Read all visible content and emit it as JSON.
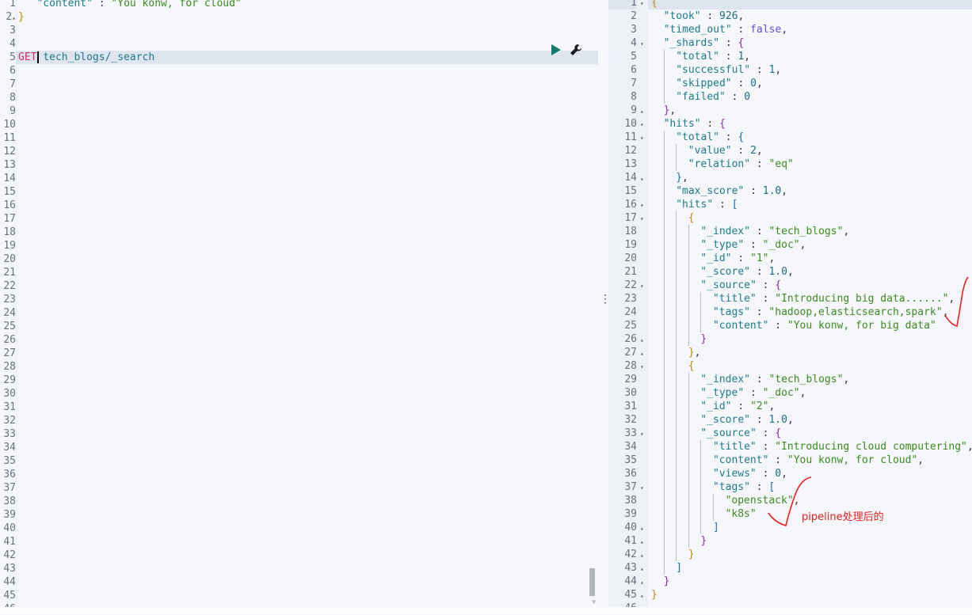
{
  "request_editor": {
    "lines": [
      {
        "num": "1",
        "fold": "",
        "tokens": [
          [
            "p",
            "   "
          ],
          [
            "k",
            "\"content\""
          ],
          [
            "p",
            " : "
          ],
          [
            "s",
            "\"You konw, for cloud\""
          ]
        ]
      },
      {
        "num": "2",
        "fold": "up",
        "tokens": [
          [
            "br1",
            "}"
          ]
        ]
      },
      {
        "num": "3",
        "fold": "",
        "tokens": []
      },
      {
        "num": "4",
        "fold": "",
        "tokens": []
      },
      {
        "num": "5",
        "fold": "",
        "active": true,
        "tokens": [
          [
            "m",
            "GET"
          ],
          [
            "p",
            " "
          ],
          [
            "u",
            "tech_blogs/_search"
          ]
        ]
      }
    ],
    "total_lines": 46,
    "run_button": "play-icon",
    "settings_button": "wrench-icon"
  },
  "response_viewer": {
    "lines": [
      {
        "num": "1",
        "fold": "down",
        "indent": 0,
        "tokens": [
          [
            "br1",
            "{"
          ]
        ]
      },
      {
        "num": "2",
        "fold": "",
        "indent": 1,
        "tokens": [
          [
            "k",
            "\"took\""
          ],
          [
            "p",
            " : "
          ],
          [
            "n",
            "926"
          ],
          [
            "p",
            ","
          ]
        ]
      },
      {
        "num": "3",
        "fold": "",
        "indent": 1,
        "tokens": [
          [
            "k",
            "\"timed_out\""
          ],
          [
            "p",
            " : "
          ],
          [
            "b",
            "false"
          ],
          [
            "p",
            ","
          ]
        ]
      },
      {
        "num": "4",
        "fold": "down",
        "indent": 1,
        "tokens": [
          [
            "k",
            "\"_shards\""
          ],
          [
            "p",
            " : "
          ],
          [
            "br2",
            "{"
          ]
        ]
      },
      {
        "num": "5",
        "fold": "",
        "indent": 2,
        "tokens": [
          [
            "k",
            "\"total\""
          ],
          [
            "p",
            " : "
          ],
          [
            "n",
            "1"
          ],
          [
            "p",
            ","
          ]
        ]
      },
      {
        "num": "6",
        "fold": "",
        "indent": 2,
        "tokens": [
          [
            "k",
            "\"successful\""
          ],
          [
            "p",
            " : "
          ],
          [
            "n",
            "1"
          ],
          [
            "p",
            ","
          ]
        ]
      },
      {
        "num": "7",
        "fold": "",
        "indent": 2,
        "tokens": [
          [
            "k",
            "\"skipped\""
          ],
          [
            "p",
            " : "
          ],
          [
            "n",
            "0"
          ],
          [
            "p",
            ","
          ]
        ]
      },
      {
        "num": "8",
        "fold": "",
        "indent": 2,
        "tokens": [
          [
            "k",
            "\"failed\""
          ],
          [
            "p",
            " : "
          ],
          [
            "n",
            "0"
          ]
        ]
      },
      {
        "num": "9",
        "fold": "up",
        "indent": 1,
        "tokens": [
          [
            "br2",
            "}"
          ],
          [
            "p",
            ","
          ]
        ]
      },
      {
        "num": "10",
        "fold": "down",
        "indent": 1,
        "tokens": [
          [
            "k",
            "\"hits\""
          ],
          [
            "p",
            " : "
          ],
          [
            "br2",
            "{"
          ]
        ]
      },
      {
        "num": "11",
        "fold": "down",
        "indent": 2,
        "tokens": [
          [
            "k",
            "\"total\""
          ],
          [
            "p",
            " : "
          ],
          [
            "br3",
            "{"
          ]
        ]
      },
      {
        "num": "12",
        "fold": "",
        "indent": 3,
        "tokens": [
          [
            "k",
            "\"value\""
          ],
          [
            "p",
            " : "
          ],
          [
            "n",
            "2"
          ],
          [
            "p",
            ","
          ]
        ]
      },
      {
        "num": "13",
        "fold": "",
        "indent": 3,
        "tokens": [
          [
            "k",
            "\"relation\""
          ],
          [
            "p",
            " : "
          ],
          [
            "s",
            "\"eq\""
          ]
        ]
      },
      {
        "num": "14",
        "fold": "up",
        "indent": 2,
        "tokens": [
          [
            "br3",
            "}"
          ],
          [
            "p",
            ","
          ]
        ]
      },
      {
        "num": "15",
        "fold": "",
        "indent": 2,
        "tokens": [
          [
            "k",
            "\"max_score\""
          ],
          [
            "p",
            " : "
          ],
          [
            "n",
            "1.0"
          ],
          [
            "p",
            ","
          ]
        ]
      },
      {
        "num": "16",
        "fold": "down",
        "indent": 2,
        "tokens": [
          [
            "k",
            "\"hits\""
          ],
          [
            "p",
            " : "
          ],
          [
            "br3",
            "["
          ]
        ]
      },
      {
        "num": "17",
        "fold": "down",
        "indent": 3,
        "tokens": [
          [
            "br1",
            "{"
          ]
        ]
      },
      {
        "num": "18",
        "fold": "",
        "indent": 4,
        "tokens": [
          [
            "k",
            "\"_index\""
          ],
          [
            "p",
            " : "
          ],
          [
            "s",
            "\"tech_blogs\""
          ],
          [
            "p",
            ","
          ]
        ]
      },
      {
        "num": "19",
        "fold": "",
        "indent": 4,
        "tokens": [
          [
            "k",
            "\"_type\""
          ],
          [
            "p",
            " : "
          ],
          [
            "s",
            "\"_doc\""
          ],
          [
            "p",
            ","
          ]
        ]
      },
      {
        "num": "20",
        "fold": "",
        "indent": 4,
        "tokens": [
          [
            "k",
            "\"_id\""
          ],
          [
            "p",
            " : "
          ],
          [
            "s",
            "\"1\""
          ],
          [
            "p",
            ","
          ]
        ]
      },
      {
        "num": "21",
        "fold": "",
        "indent": 4,
        "tokens": [
          [
            "k",
            "\"_score\""
          ],
          [
            "p",
            " : "
          ],
          [
            "n",
            "1.0"
          ],
          [
            "p",
            ","
          ]
        ]
      },
      {
        "num": "22",
        "fold": "down",
        "indent": 4,
        "tokens": [
          [
            "k",
            "\"_source\""
          ],
          [
            "p",
            " : "
          ],
          [
            "br2",
            "{"
          ]
        ]
      },
      {
        "num": "23",
        "fold": "",
        "indent": 5,
        "tokens": [
          [
            "k",
            "\"title\""
          ],
          [
            "p",
            " : "
          ],
          [
            "s",
            "\"Introducing big data......\""
          ],
          [
            "p",
            ","
          ]
        ]
      },
      {
        "num": "24",
        "fold": "",
        "indent": 5,
        "tokens": [
          [
            "k",
            "\"tags\""
          ],
          [
            "p",
            " : "
          ],
          [
            "s",
            "\"hadoop,elasticsearch,spark\""
          ],
          [
            "p",
            ","
          ]
        ]
      },
      {
        "num": "25",
        "fold": "",
        "indent": 5,
        "tokens": [
          [
            "k",
            "\"content\""
          ],
          [
            "p",
            " : "
          ],
          [
            "s",
            "\"You konw, for big data\""
          ]
        ]
      },
      {
        "num": "26",
        "fold": "up",
        "indent": 4,
        "tokens": [
          [
            "br2",
            "}"
          ]
        ]
      },
      {
        "num": "27",
        "fold": "up",
        "indent": 3,
        "tokens": [
          [
            "br1",
            "}"
          ],
          [
            "p",
            ","
          ]
        ]
      },
      {
        "num": "28",
        "fold": "down",
        "indent": 3,
        "tokens": [
          [
            "br1",
            "{"
          ]
        ]
      },
      {
        "num": "29",
        "fold": "",
        "indent": 4,
        "tokens": [
          [
            "k",
            "\"_index\""
          ],
          [
            "p",
            " : "
          ],
          [
            "s",
            "\"tech_blogs\""
          ],
          [
            "p",
            ","
          ]
        ]
      },
      {
        "num": "30",
        "fold": "",
        "indent": 4,
        "tokens": [
          [
            "k",
            "\"_type\""
          ],
          [
            "p",
            " : "
          ],
          [
            "s",
            "\"_doc\""
          ],
          [
            "p",
            ","
          ]
        ]
      },
      {
        "num": "31",
        "fold": "",
        "indent": 4,
        "tokens": [
          [
            "k",
            "\"_id\""
          ],
          [
            "p",
            " : "
          ],
          [
            "s",
            "\"2\""
          ],
          [
            "p",
            ","
          ]
        ]
      },
      {
        "num": "32",
        "fold": "",
        "indent": 4,
        "tokens": [
          [
            "k",
            "\"_score\""
          ],
          [
            "p",
            " : "
          ],
          [
            "n",
            "1.0"
          ],
          [
            "p",
            ","
          ]
        ]
      },
      {
        "num": "33",
        "fold": "down",
        "indent": 4,
        "tokens": [
          [
            "k",
            "\"_source\""
          ],
          [
            "p",
            " : "
          ],
          [
            "br2",
            "{"
          ]
        ]
      },
      {
        "num": "34",
        "fold": "",
        "indent": 5,
        "tokens": [
          [
            "k",
            "\"title\""
          ],
          [
            "p",
            " : "
          ],
          [
            "s",
            "\"Introducing cloud computering\""
          ],
          [
            "p",
            ","
          ]
        ]
      },
      {
        "num": "35",
        "fold": "",
        "indent": 5,
        "tokens": [
          [
            "k",
            "\"content\""
          ],
          [
            "p",
            " : "
          ],
          [
            "s",
            "\"You konw, for cloud\""
          ],
          [
            "p",
            ","
          ]
        ]
      },
      {
        "num": "36",
        "fold": "",
        "indent": 5,
        "tokens": [
          [
            "k",
            "\"views\""
          ],
          [
            "p",
            " : "
          ],
          [
            "n",
            "0"
          ],
          [
            "p",
            ","
          ]
        ]
      },
      {
        "num": "37",
        "fold": "down",
        "indent": 5,
        "tokens": [
          [
            "k",
            "\"tags\""
          ],
          [
            "p",
            " : "
          ],
          [
            "br3",
            "["
          ]
        ]
      },
      {
        "num": "38",
        "fold": "",
        "indent": 6,
        "tokens": [
          [
            "s",
            "\"openstack\""
          ],
          [
            "p",
            ","
          ]
        ]
      },
      {
        "num": "39",
        "fold": "",
        "indent": 6,
        "tokens": [
          [
            "s",
            "\"k8s\""
          ]
        ]
      },
      {
        "num": "40",
        "fold": "up",
        "indent": 5,
        "tokens": [
          [
            "br3",
            "]"
          ]
        ]
      },
      {
        "num": "41",
        "fold": "up",
        "indent": 4,
        "tokens": [
          [
            "br2",
            "}"
          ]
        ]
      },
      {
        "num": "42",
        "fold": "up",
        "indent": 3,
        "tokens": [
          [
            "br1",
            "}"
          ]
        ]
      },
      {
        "num": "43",
        "fold": "up",
        "indent": 2,
        "tokens": [
          [
            "br3",
            "]"
          ]
        ]
      },
      {
        "num": "44",
        "fold": "up",
        "indent": 1,
        "tokens": [
          [
            "br2",
            "}"
          ]
        ]
      },
      {
        "num": "45",
        "fold": "up",
        "indent": 0,
        "tokens": [
          [
            "br1",
            "}"
          ]
        ]
      },
      {
        "num": "46",
        "fold": "",
        "indent": 0,
        "tokens": []
      }
    ]
  },
  "annotation": {
    "text": "pipeline处理后的",
    "color": "#e8201c"
  }
}
